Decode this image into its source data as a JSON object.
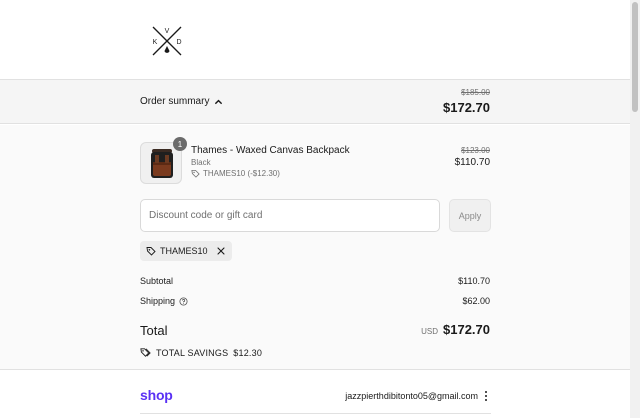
{
  "brand": {
    "logo_letters": [
      "V",
      "K",
      "D"
    ]
  },
  "summary": {
    "toggle_label": "Order summary",
    "original_total": "$185.00",
    "total": "$172.70"
  },
  "product": {
    "name": "Thames - Waxed Canvas Backpack",
    "variant": "Black",
    "discount": "THAMES10 (-$12.30)",
    "quantity": "1",
    "original_price": "$123.00",
    "price": "$110.70"
  },
  "discount": {
    "placeholder": "Discount code or gift card",
    "apply_label": "Apply",
    "applied_code": "THAMES10"
  },
  "totals": {
    "subtotal_label": "Subtotal",
    "subtotal_value": "$110.70",
    "shipping_label": "Shipping",
    "shipping_value": "$62.00",
    "total_label": "Total",
    "currency": "USD",
    "total_value": "$172.70",
    "savings_label": "TOTAL SAVINGS",
    "savings_value": "$12.30"
  },
  "shop": {
    "logo": "shop",
    "email": "jazzpierthdibitonto05@gmail.com"
  },
  "colors": {
    "shop_brand": "#5a31f4",
    "summary_bg": "#f5f5f5",
    "panel_bg": "#fafafa"
  }
}
